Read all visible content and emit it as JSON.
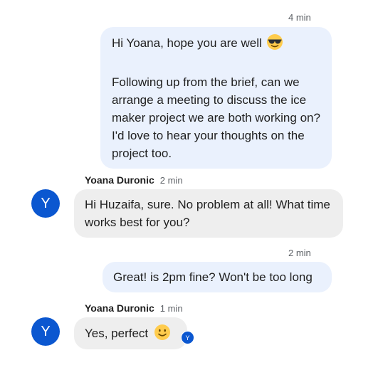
{
  "messages": [
    {
      "direction": "outgoing",
      "time": "4 min",
      "line1": "Hi Yoana, hope you are well",
      "line1_emoji": "sunglasses-face",
      "paragraph2": "Following up from the brief, can we arrange a meeting to discuss the ice maker project we are both working on? I'd love to hear your thoughts on the project too."
    },
    {
      "direction": "incoming",
      "sender": "Yoana Duronic",
      "time": "2 min",
      "avatar_letter": "Y",
      "text": "Hi Huzaifa, sure. No problem at all! What time works best for you?"
    },
    {
      "direction": "outgoing",
      "time": "2 min",
      "text": "Great! is 2pm fine? Won't be too long"
    },
    {
      "direction": "incoming",
      "sender": "Yoana Duronic",
      "time": "1 min",
      "avatar_letter": "Y",
      "text": "Yes, perfect",
      "emoji": "slightly-smiling-face",
      "read_receipt_letter": "Y"
    }
  ],
  "colors": {
    "outgoing_bubble": "#eaf1fd",
    "incoming_bubble": "#eeeeee",
    "avatar": "#0b57d0",
    "timestamp": "#5f6368"
  }
}
